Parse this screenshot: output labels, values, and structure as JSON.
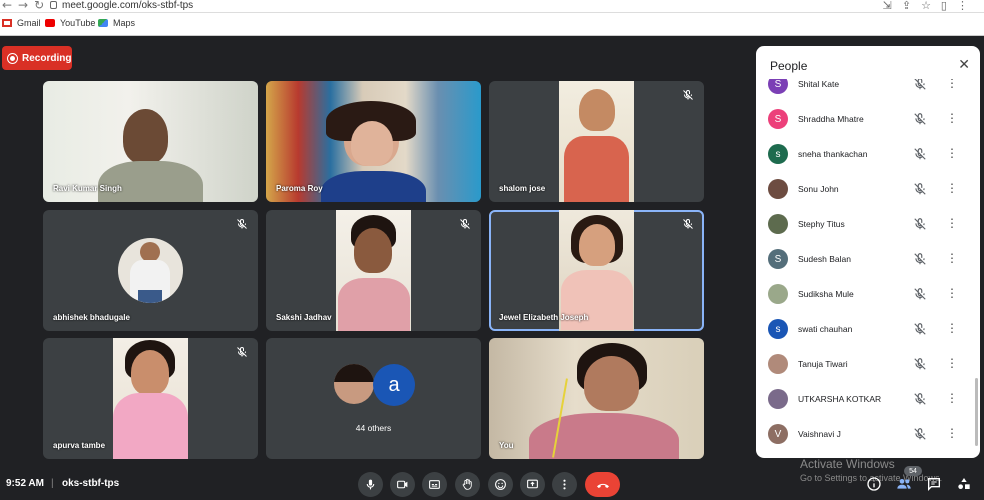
{
  "browser": {
    "url": "meet.google.com/oks-stbf-tps",
    "bookmarks": [
      "Gmail",
      "YouTube",
      "Maps"
    ]
  },
  "recording_label": "Recording",
  "tiles": [
    {
      "name": "Ravi Kumar Singh",
      "muted": false
    },
    {
      "name": "Paroma Roy",
      "muted": false
    },
    {
      "name": "shalom jose",
      "muted": true
    },
    {
      "name": "abhishek bhadugale",
      "muted": true
    },
    {
      "name": "Sakshi Jadhav",
      "muted": true
    },
    {
      "name": "Jewel Elizabeth Joseph",
      "muted": true
    },
    {
      "name": "apurva tambe",
      "muted": true
    },
    {
      "name": "44 others",
      "muted": false,
      "avatar_letter": "a"
    },
    {
      "name": "You",
      "muted": false
    }
  ],
  "people_panel": {
    "title": "People",
    "people": [
      {
        "name": "Shital Kate",
        "initial": "S",
        "color": "#7b3fb5"
      },
      {
        "name": "Shraddha Mhatre",
        "initial": "S",
        "color": "#ec407a"
      },
      {
        "name": "sneha thankachan",
        "initial": "s",
        "color": "#1e6b4e"
      },
      {
        "name": "Sonu John",
        "initial": "",
        "color": "#6d4c41"
      },
      {
        "name": "Stephy Titus",
        "initial": "",
        "color": "#5d6b4e"
      },
      {
        "name": "Sudesh Balan",
        "initial": "S",
        "color": "#546e7a"
      },
      {
        "name": "Sudiksha Mule",
        "initial": "",
        "color": "#9aa88a"
      },
      {
        "name": "swati chauhan",
        "initial": "s",
        "color": "#1a56b5"
      },
      {
        "name": "Tanuja Tiwari",
        "initial": "",
        "color": "#b08a7a"
      },
      {
        "name": "UTKARSHA KOTKAR",
        "initial": "",
        "color": "#7a6a8a"
      },
      {
        "name": "Vaishnavi J",
        "initial": "V",
        "color": "#8d6e63"
      }
    ]
  },
  "bottom": {
    "time": "9:52 AM",
    "separator": "|",
    "meeting_code": "oks-stbf-tps",
    "participant_count": "54"
  },
  "watermark": {
    "line1": "Activate Windows",
    "line2": "Go to Settings to activate Windows."
  }
}
